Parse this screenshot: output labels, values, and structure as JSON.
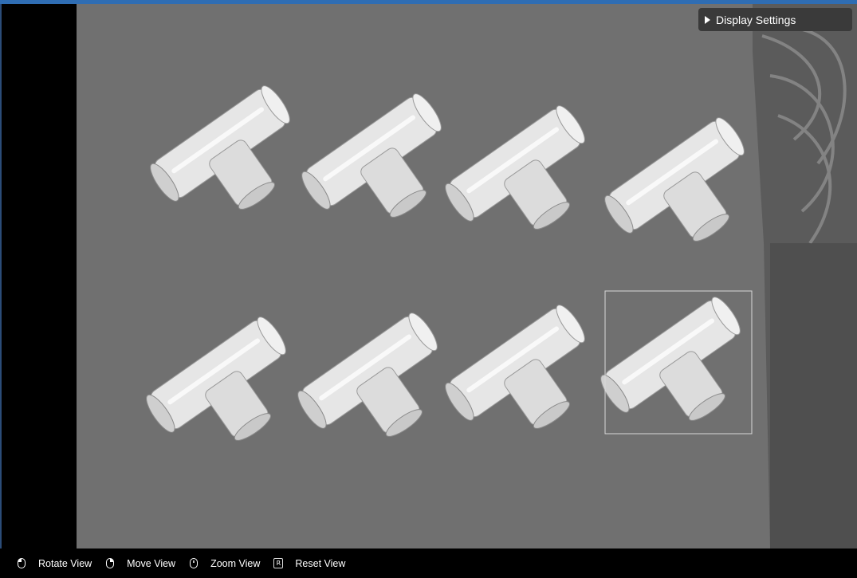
{
  "display_settings": {
    "label": "Display Settings",
    "icon": "triangle-right-icon"
  },
  "statusbar": {
    "hints": [
      {
        "icon": "mouse-left-icon",
        "label": "Rotate View"
      },
      {
        "icon": "mouse-right-icon",
        "label": "Move View"
      },
      {
        "icon": "mouse-wheel-icon",
        "label": "Zoom View"
      },
      {
        "icon": "r-key-icon",
        "key": "R",
        "label": "Reset View"
      }
    ]
  },
  "colors": {
    "top_accent": "#2f6db3",
    "background": "#000000",
    "panel": "#3a3a3a",
    "text": "#ffffff"
  }
}
